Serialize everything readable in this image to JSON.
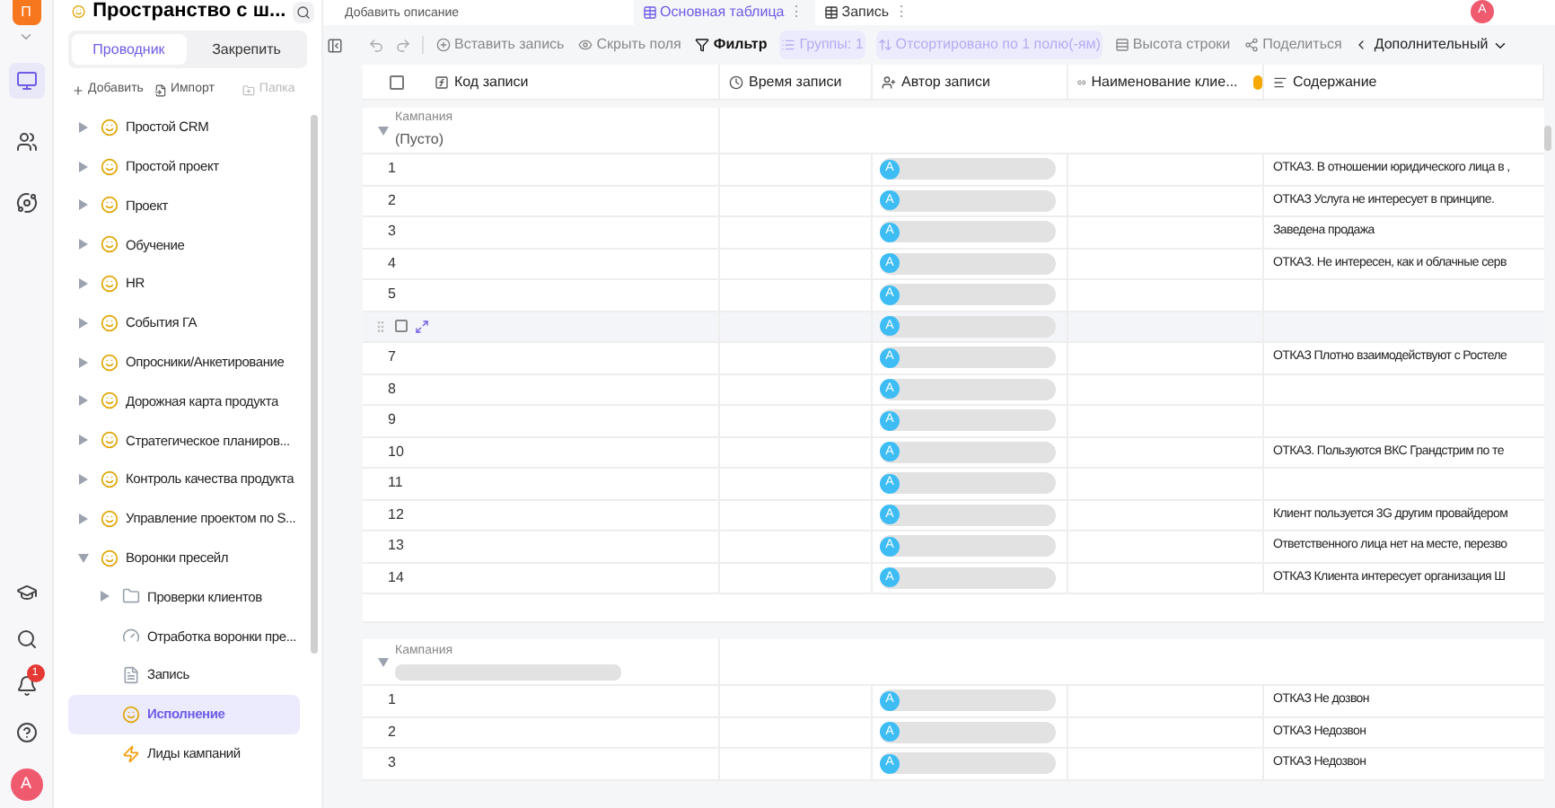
{
  "rail": {
    "logo": "П",
    "items": [
      {
        "kind": "monitor",
        "selected": true
      },
      {
        "kind": "users",
        "selected": false
      },
      {
        "kind": "planet",
        "selected": false
      }
    ],
    "notifications": "1",
    "avatar": "A"
  },
  "sidebar": {
    "title": "Пространство с ш...",
    "tabs": [
      {
        "label": "Проводник",
        "selected": true
      },
      {
        "label": "Закрепить",
        "selected": false
      }
    ],
    "actions": [
      {
        "kind": "add",
        "label": "Добавить",
        "disabled": false
      },
      {
        "kind": "import",
        "label": "Импорт",
        "disabled": false
      },
      {
        "kind": "folder",
        "label": "Папка",
        "disabled": true
      }
    ],
    "tree": [
      {
        "label": "Простой CRM",
        "expanded": false,
        "selected": false
      },
      {
        "label": "Простой проект",
        "expanded": false,
        "selected": false
      },
      {
        "label": "Проект",
        "expanded": false,
        "selected": false
      },
      {
        "label": "Обучение",
        "expanded": false,
        "selected": false
      },
      {
        "label": "HR",
        "expanded": false,
        "selected": false
      },
      {
        "label": "События ГА",
        "expanded": false,
        "selected": false
      },
      {
        "label": "Опросники/Анкетирование",
        "expanded": false,
        "selected": false
      },
      {
        "label": "Дорожная карта продукта",
        "expanded": false,
        "selected": false
      },
      {
        "label": "Стратегическое планиров...",
        "expanded": false,
        "selected": false
      },
      {
        "label": "Контроль качества продукта",
        "expanded": false,
        "selected": false
      },
      {
        "label": "Управление проектом по S...",
        "expanded": false,
        "selected": false
      },
      {
        "label": "Воронки пресейл",
        "expanded": true,
        "selected": false,
        "children": [
          {
            "kind": "folder",
            "label": "Проверки клиентов",
            "expanded": false,
            "selected": false
          },
          {
            "kind": "dashboard",
            "label": "Отработка воронки пре...",
            "selected": false
          },
          {
            "kind": "form",
            "label": "Запись",
            "selected": false
          },
          {
            "kind": "emoji",
            "label": "Исполнение",
            "selected": true
          },
          {
            "kind": "bolt",
            "label": "Лиды кампаний",
            "selected": false
          }
        ]
      }
    ]
  },
  "header": {
    "description": "Добавить описание",
    "views": [
      {
        "label": "Основная таблица",
        "menu": "⋮",
        "selected": true
      },
      {
        "label": "Запись",
        "menu": "⋮",
        "selected": false
      }
    ],
    "avatar": "A"
  },
  "toolbar": [
    {
      "kind": "insert",
      "label": "Вставить запись",
      "active": false
    },
    {
      "kind": "hide",
      "label": "Скрыть поля",
      "active": false
    },
    {
      "kind": "filter",
      "label": "Фильтр",
      "active": true
    },
    {
      "kind": "group",
      "label": "Группы: 1",
      "active": true
    },
    {
      "kind": "sort",
      "label": "Отсортировано по 1 полю(-ям)",
      "active": true
    },
    {
      "kind": "height",
      "label": "Высота строки",
      "active": false
    },
    {
      "kind": "share",
      "label": "Поделиться",
      "active": false
    },
    {
      "kind": "more",
      "label": "Дополнительный",
      "active": false
    }
  ],
  "table": {
    "select_all": {
      "checked": false
    },
    "columns": [
      {
        "kind": "formula",
        "label": "Код записи",
        "warning": false
      },
      {
        "kind": "time",
        "label": "Время записи",
        "warning": false
      },
      {
        "kind": "user",
        "label": "Автор записи",
        "warning": false
      },
      {
        "kind": "lookup",
        "label": "Наименование клие...",
        "warning": true
      },
      {
        "kind": "text",
        "label": "Содержание",
        "warning": false
      }
    ],
    "groups": [
      {
        "label": "Кампания",
        "value": "(Пусто)",
        "expanded": true,
        "rows": [
          {
            "number": "1",
            "author": "A",
            "content": "ОТКАЗ. В отношении юридического лица в ,",
            "hovered": false
          },
          {
            "number": "2",
            "author": "A",
            "content": "ОТКАЗ Услуга не интересует в принципе.",
            "hovered": false
          },
          {
            "number": "3",
            "author": "A",
            "content": "Заведена продажа",
            "hovered": false
          },
          {
            "number": "4",
            "author": "A",
            "content": "ОТКАЗ. Не интересен, как и облачные серв",
            "hovered": false
          },
          {
            "number": "5",
            "author": "A",
            "content": "",
            "hovered": false
          },
          {
            "author": "A",
            "content": "",
            "hovered": true
          },
          {
            "number": "7",
            "author": "A",
            "content": "ОТКАЗ Плотно взаимодействуют с Ростеле",
            "hovered": false
          },
          {
            "number": "8",
            "author": "A",
            "content": "",
            "hovered": false
          },
          {
            "number": "9",
            "author": "A",
            "content": "",
            "hovered": false
          },
          {
            "number": "10",
            "author": "A",
            "content": "ОТКАЗ. Пользуются ВКС Грандстрим по те",
            "hovered": false
          },
          {
            "number": "11",
            "author": "A",
            "content": "",
            "hovered": false
          },
          {
            "number": "12",
            "author": "A",
            "content": "Клиент пользуется 3G другим провайдером",
            "hovered": false
          },
          {
            "number": "13",
            "author": "A",
            "content": "Ответственного лица нет на месте, перезво",
            "hovered": false
          },
          {
            "number": "14",
            "author": "A",
            "content": "ОТКАЗ Клиента интересует организация Ш",
            "hovered": false
          }
        ]
      },
      {
        "label": "Кампания",
        "expanded": true,
        "rows": [
          {
            "number": "1",
            "author": "A",
            "content": "ОТКАЗ Не дозвон",
            "hovered": false
          },
          {
            "number": "2",
            "author": "A",
            "content": "ОТКАЗ Недозвон",
            "hovered": false
          },
          {
            "number": "3",
            "author": "A",
            "content": "ОТКАЗ Недозвон",
            "hovered": false
          }
        ]
      }
    ]
  }
}
